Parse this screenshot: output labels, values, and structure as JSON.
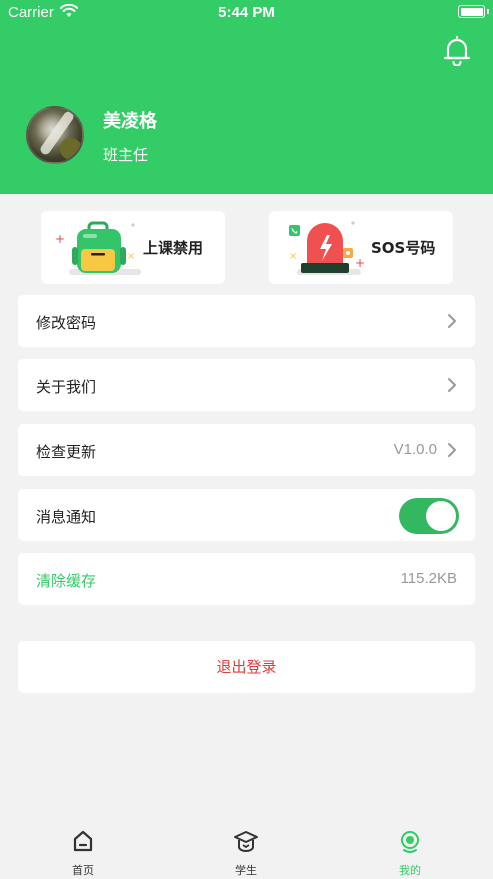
{
  "status_bar": {
    "carrier": "Carrier",
    "time": "5:44 PM"
  },
  "profile": {
    "name": "美凌格",
    "role": "班主任"
  },
  "quick_actions": [
    {
      "label": "上课禁用",
      "icon": "schoolbag-icon"
    },
    {
      "label": "SOS号码",
      "icon": "alarm-siren-icon"
    }
  ],
  "settings": {
    "change_password": "修改密码",
    "about_us": "关于我们",
    "check_update": "检查更新",
    "version": "V1.0.0",
    "notifications": "消息通知",
    "notifications_on": true,
    "clear_cache": "清除缓存",
    "cache_size": "115.2KB"
  },
  "logout": "退出登录",
  "tabbar": {
    "home": "首页",
    "students": "学生",
    "mine": "我的",
    "active": "mine"
  },
  "colors": {
    "brand_green": "#33cc66",
    "logout_red": "#e23b3b",
    "bg": "#f2f2f2"
  }
}
